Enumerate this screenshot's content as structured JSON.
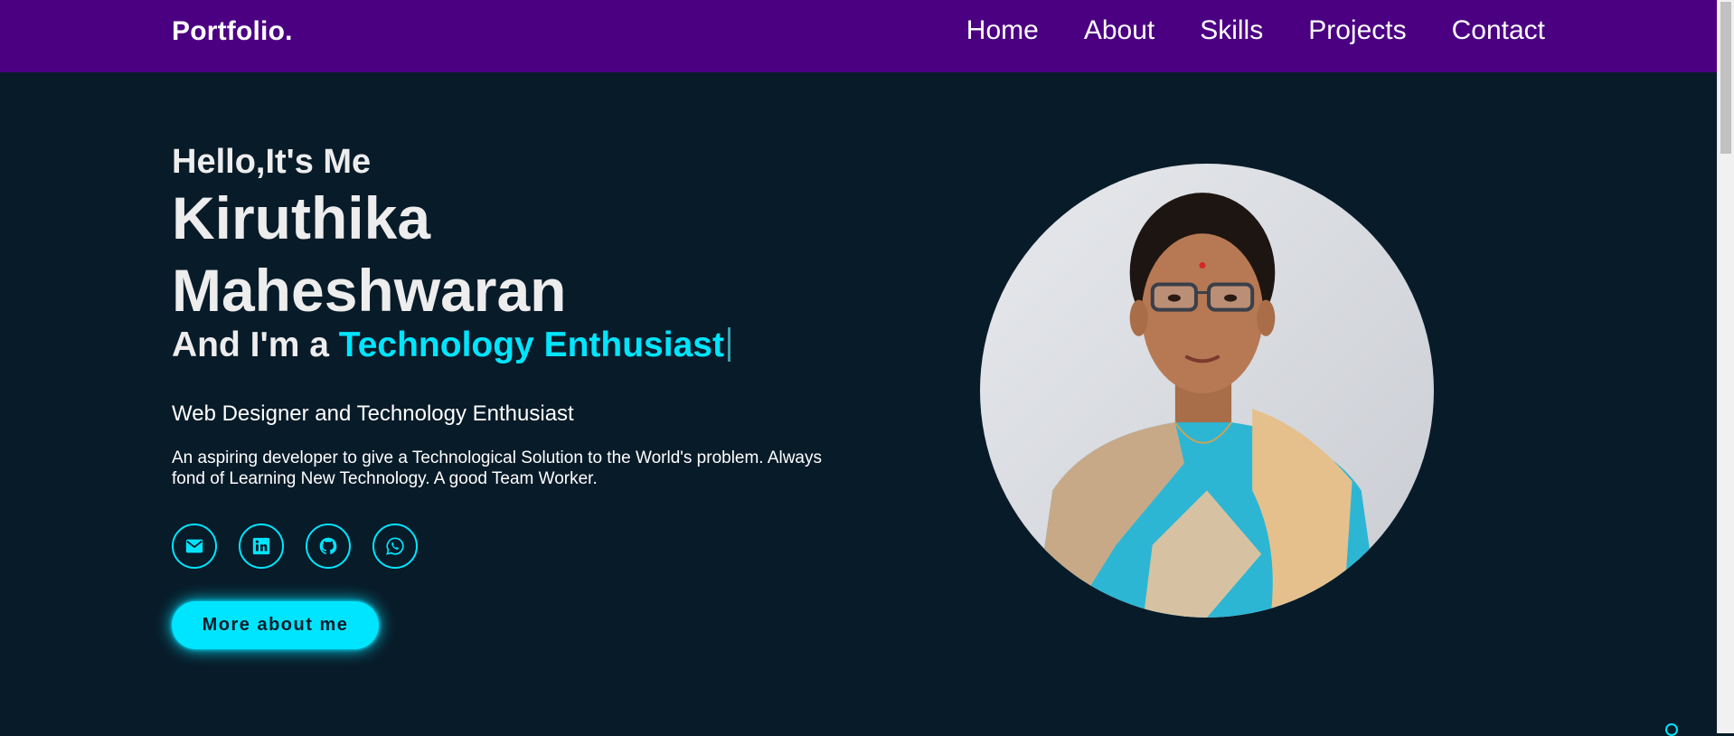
{
  "header": {
    "logo": "Portfolio.",
    "nav": [
      {
        "label": "Home"
      },
      {
        "label": "About"
      },
      {
        "label": "Skills"
      },
      {
        "label": "Projects"
      },
      {
        "label": "Contact"
      }
    ]
  },
  "hero": {
    "greeting": "Hello,It's Me",
    "name_line1": "Kiruthika",
    "name_line2": "Maheshwaran",
    "role_prefix": "And I'm a ",
    "role_typed": "Technology Enthusiast",
    "subtitle": "Web Designer and Technology Enthusiast",
    "description": "An aspiring developer to give a Technological Solution to the World's problem. Always fond of Learning New Technology. A good Team Worker.",
    "socials": [
      {
        "icon": "mail-icon"
      },
      {
        "icon": "linkedin-icon"
      },
      {
        "icon": "github-icon"
      },
      {
        "icon": "whatsapp-icon"
      }
    ],
    "cta_label": "More about me"
  },
  "colors": {
    "header_bg": "#4b0082",
    "page_bg": "#081b29",
    "accent": "#00e5ff",
    "text": "#ededed"
  }
}
